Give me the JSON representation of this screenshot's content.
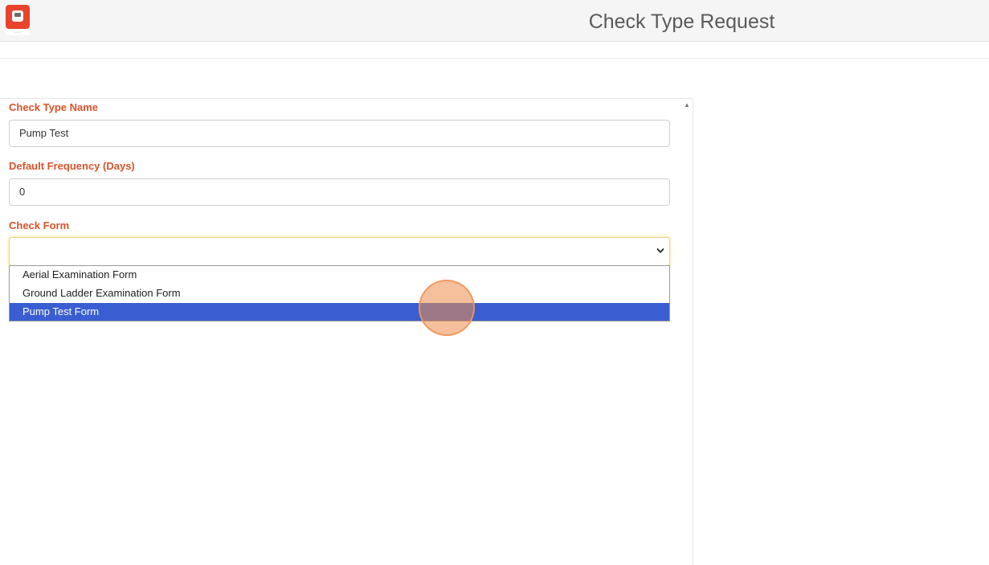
{
  "header": {
    "title": "Check Type Request",
    "logo_icon": "fire-truck-icon",
    "brand_color": "#e8442c"
  },
  "form": {
    "check_type_name": {
      "label": "Check Type Name",
      "value": "Pump Test"
    },
    "default_frequency": {
      "label": "Default Frequency (Days)",
      "value": "0"
    },
    "check_form": {
      "label": "Check Form",
      "value": "",
      "options": [
        "Aerial Examination Form",
        "Ground Ladder Examination Form",
        "Pump Test Form"
      ],
      "highlighted_option": "Pump Test Form"
    }
  },
  "colors": {
    "label": "#d9532b",
    "selected_option_bg": "#3a5ed1",
    "click_indicator": "#ed8c48"
  }
}
